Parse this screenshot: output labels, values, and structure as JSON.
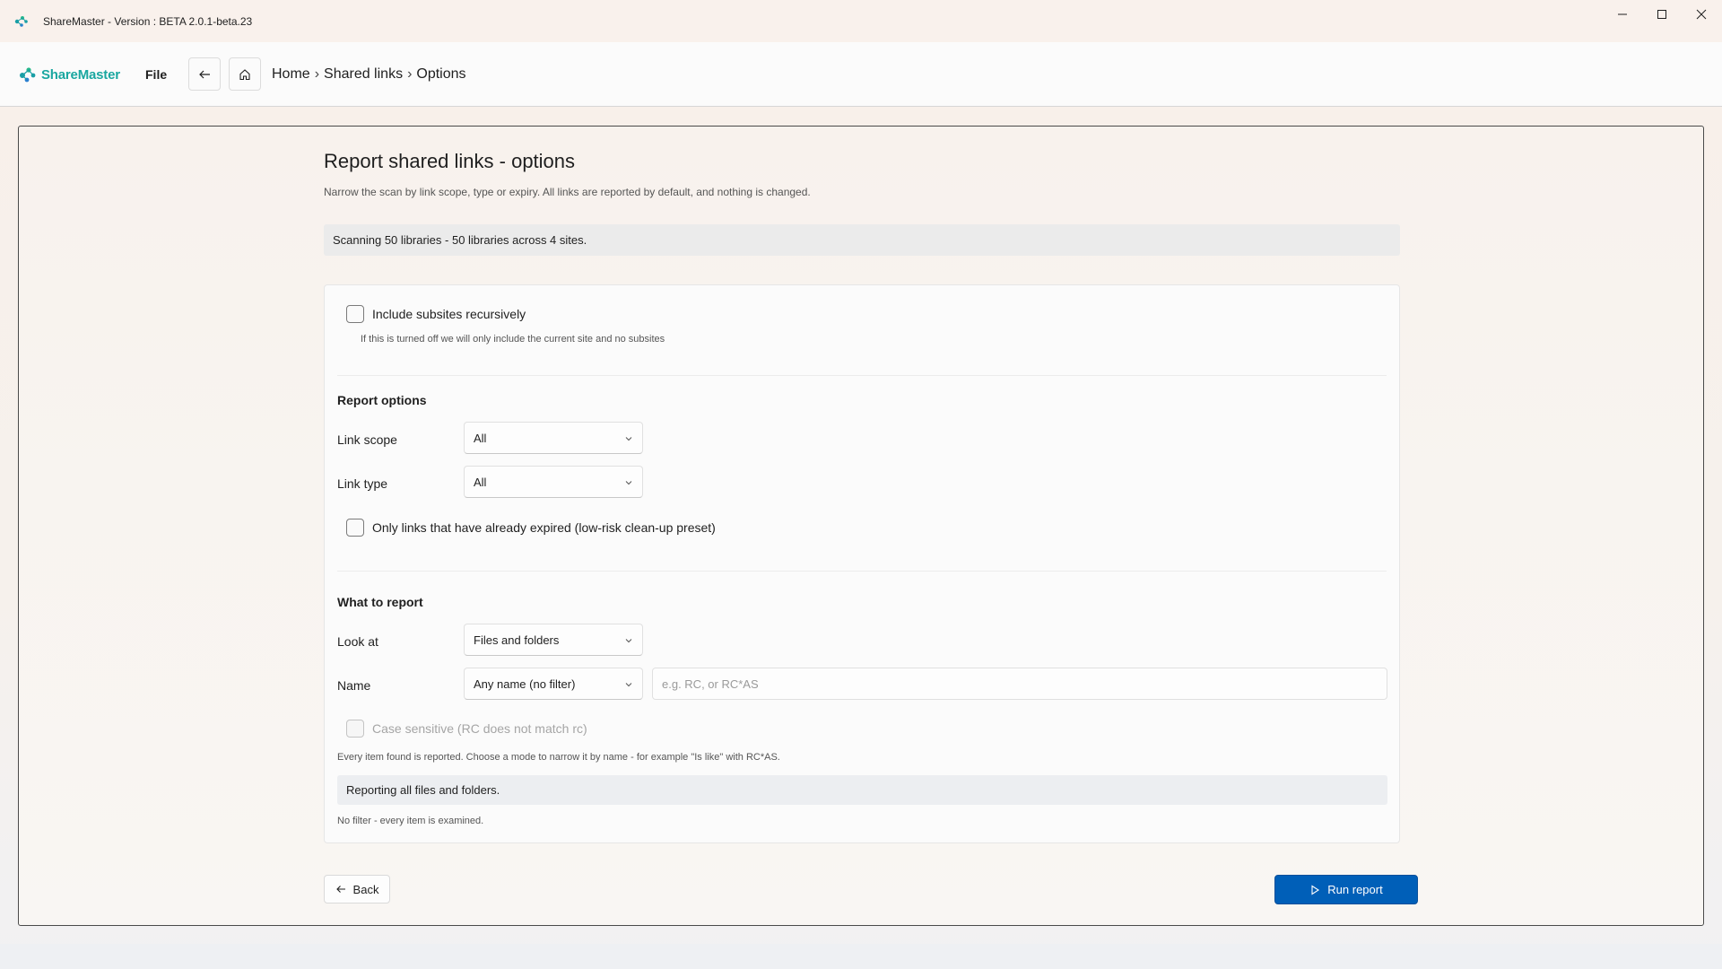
{
  "window": {
    "title": "ShareMaster - Version : BETA 2.0.1-beta.23",
    "controls": [
      "minimize-icon",
      "maximize-icon",
      "close-icon"
    ]
  },
  "header": {
    "logo_text": "ShareMaster",
    "file_menu": "File",
    "breadcrumb": [
      "Home",
      "Shared links",
      "Options"
    ],
    "breadcrumb_separator": "›"
  },
  "page": {
    "title": "Report shared links - options",
    "description": "Narrow the scan by link scope, type or expiry. All links are reported by default, and nothing is changed.",
    "scan_banner": "Scanning 50 libraries - 50 libraries across 4 sites."
  },
  "options": {
    "include_subsites": {
      "label": "Include subsites recursively",
      "hint": "If this is turned off we will only include the current site and no subsites",
      "checked": false
    },
    "report_options_title": "Report options",
    "link_scope": {
      "label": "Link scope",
      "value": "All"
    },
    "link_type": {
      "label": "Link type",
      "value": "All"
    },
    "expired_only": {
      "label": "Only links that have already expired (low-risk clean-up preset)",
      "checked": false
    },
    "what_to_report_title": "What to report",
    "look_at": {
      "label": "Look at",
      "value": "Files and folders"
    },
    "name": {
      "label": "Name",
      "value": "Any name (no filter)",
      "placeholder": "e.g. RC, or RC*AS"
    },
    "case_sensitive": {
      "label": "Case sensitive (RC does not match rc)",
      "checked": false,
      "disabled": true
    },
    "name_hint": "Every item found is reported. Choose a mode to narrow it by name - for example \"Is like\" with RC*AS.",
    "reporting_info": "Reporting all files and folders.",
    "filter_note": "No filter - every item is examined."
  },
  "footer": {
    "back_label": "Back",
    "run_label": "Run report"
  },
  "colors": {
    "accent": "#005fb8",
    "brand": "#1aa7a0"
  }
}
